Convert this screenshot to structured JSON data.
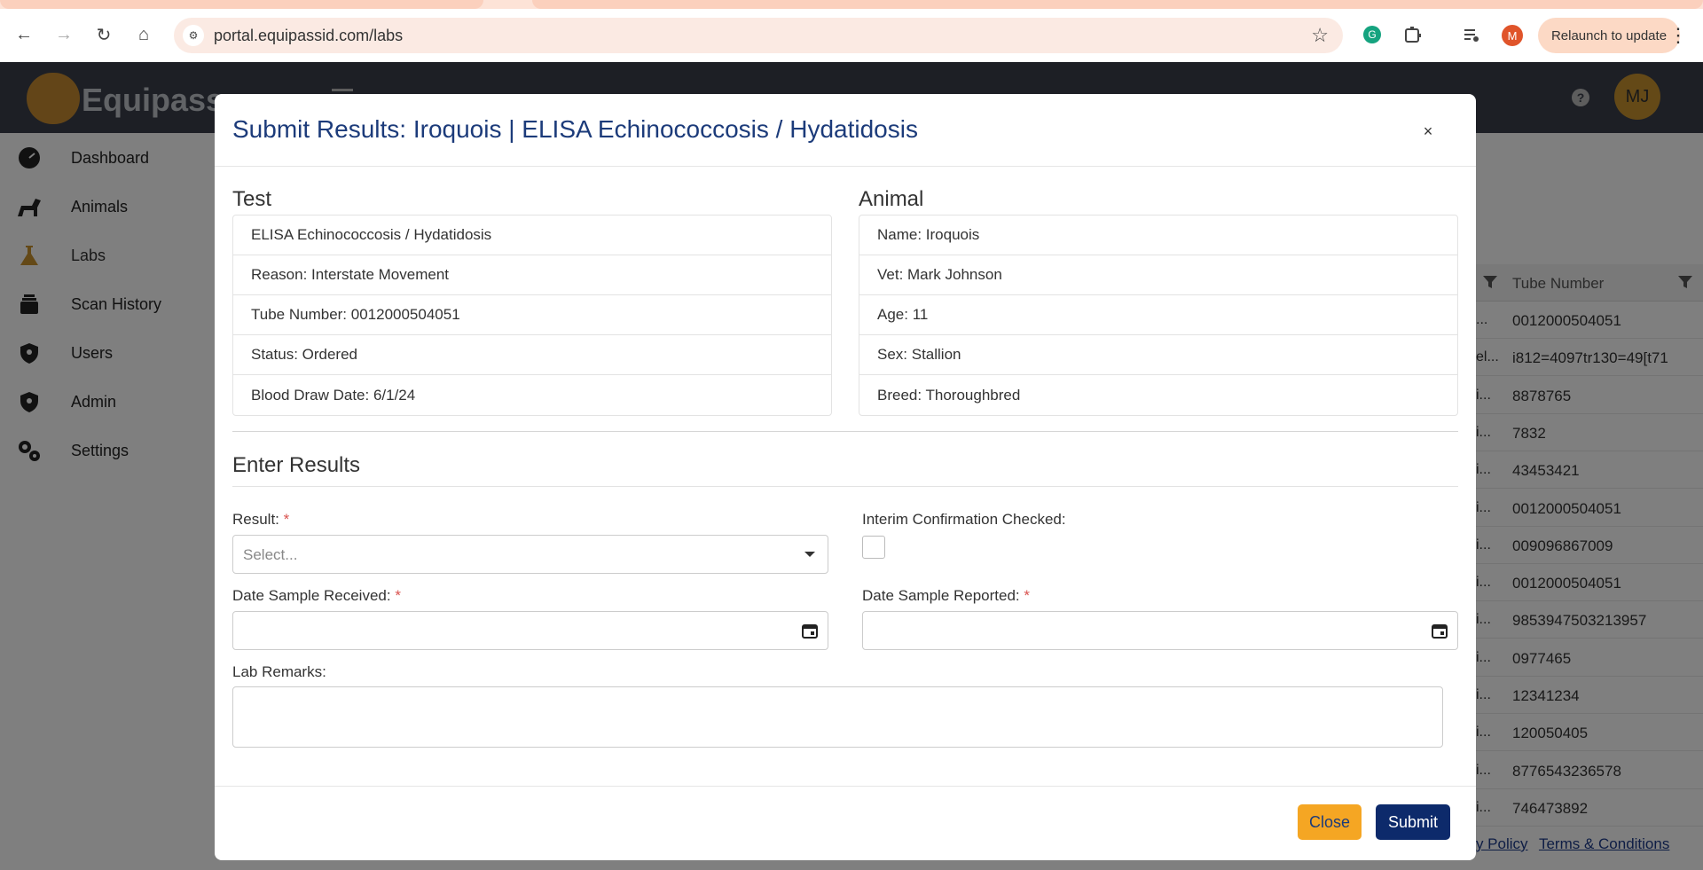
{
  "browser": {
    "url": "portal.equipassid.com/labs",
    "relaunch_label": "Relaunch to update",
    "profile_initial": "M"
  },
  "app": {
    "brand": "Equipass",
    "avatar_initials": "MJ",
    "help_label": "?",
    "sidebar": [
      {
        "label": "Dashboard",
        "icon": "dashboard-icon"
      },
      {
        "label": "Animals",
        "icon": "horse-icon"
      },
      {
        "label": "Labs",
        "icon": "flask-icon"
      },
      {
        "label": "Scan History",
        "icon": "layers-icon"
      },
      {
        "label": "Users",
        "icon": "shield-icon"
      },
      {
        "label": "Admin",
        "icon": "shield-icon"
      },
      {
        "label": "Settings",
        "icon": "gears-icon"
      }
    ],
    "grid": {
      "column_header": "Tube Number",
      "rows": [
        {
          "cut": "...",
          "tube": "0012000504051"
        },
        {
          "cut": "el...",
          "tube": "i812=4097tr130=49[t71"
        },
        {
          "cut": "i...",
          "tube": "8878765"
        },
        {
          "cut": "i...",
          "tube": "7832"
        },
        {
          "cut": "i...",
          "tube": "43453421"
        },
        {
          "cut": "i...",
          "tube": "0012000504051"
        },
        {
          "cut": "i...",
          "tube": "009096867009"
        },
        {
          "cut": "i...",
          "tube": "0012000504051"
        },
        {
          "cut": "i...",
          "tube": "9853947503213957"
        },
        {
          "cut": "i...",
          "tube": "0977465"
        },
        {
          "cut": "i...",
          "tube": "12341234"
        },
        {
          "cut": "i...",
          "tube": "120050405"
        },
        {
          "cut": "i...",
          "tube": "8776543236578"
        },
        {
          "cut": "i...",
          "tube": "746473892"
        }
      ]
    },
    "footer": {
      "privacy": "acy Policy",
      "terms": "Terms & Conditions"
    }
  },
  "modal": {
    "title": "Submit Results: Iroquois | ELISA Echinococcosis / Hydatidosis",
    "close_symbol": "×",
    "test": {
      "heading": "Test",
      "items": [
        "ELISA Echinococcosis / Hydatidosis",
        "Reason: Interstate Movement",
        "Tube Number: 0012000504051",
        "Status: Ordered",
        "Blood Draw Date: 6/1/24"
      ]
    },
    "animal": {
      "heading": "Animal",
      "items": [
        "Name: Iroquois",
        "Vet: Mark Johnson",
        "Age: 11",
        "Sex: Stallion",
        "Breed: Thoroughbred"
      ]
    },
    "enter_results": {
      "heading": "Enter Results",
      "result_label": "Result:",
      "result_placeholder": "Select...",
      "interim_label": "Interim Confirmation Checked:",
      "interim_checked": false,
      "date_received_label": "Date Sample Received:",
      "date_reported_label": "Date Sample Reported:",
      "remarks_label": "Lab Remarks:",
      "required_mark": "*"
    },
    "buttons": {
      "close": "Close",
      "submit": "Submit"
    }
  }
}
